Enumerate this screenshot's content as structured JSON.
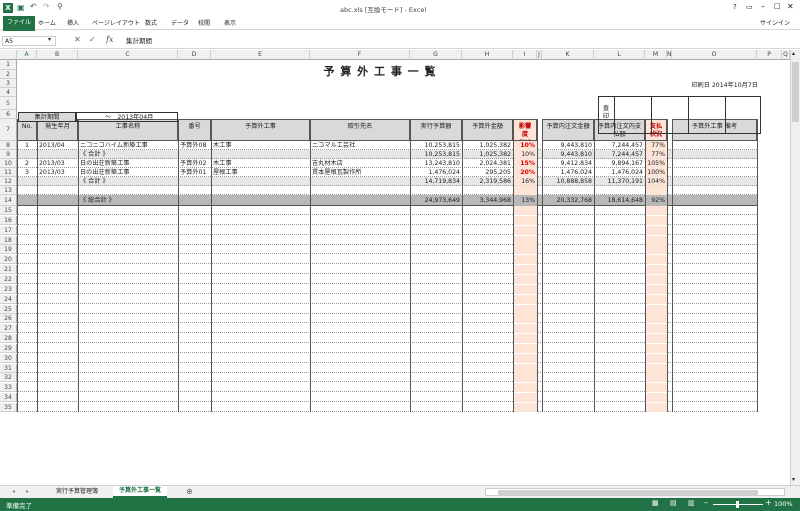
{
  "window": {
    "title": "abc.xls [互換モード] - Excel",
    "help": "?",
    "signin": "サインイン"
  },
  "ribbon_tabs": [
    "ファイル",
    "ホーム",
    "挿入",
    "ページレイアウト",
    "数式",
    "データ",
    "校閲",
    "表示"
  ],
  "formula_bar": {
    "name_box": "A5",
    "fx": "fx",
    "content": "集計期間"
  },
  "columns": [
    "A",
    "B",
    "C",
    "D",
    "E",
    "F",
    "G",
    "H",
    "I",
    "J",
    "K",
    "L",
    "M",
    "N",
    "O",
    "P",
    "Q",
    "R"
  ],
  "sheet": {
    "title": "予 算 外 工 事 一 覧",
    "print_date": "印刷日 2014年10月7日",
    "approval_label": "査印",
    "period_label": "集計期間",
    "period_value": "～　2013年04月",
    "headers": {
      "no": "No.",
      "date": "発生年月",
      "project": "工事名称",
      "code": "番号",
      "extra_work": "予算外工事",
      "vendor": "取引先名",
      "budget": "実行予算額",
      "extra_amount": "予算外金額",
      "impact": "影響度(%)",
      "order_amount": "予算内注文金額",
      "paid_amount": "予算内注文内支払額",
      "pay_status": "支払状況",
      "remarks": "予算外工事 備考"
    },
    "rows": [
      {
        "r": "8",
        "no": "1",
        "date": "2013/04",
        "project": "ニコニコハイム新築工事",
        "code": "予算外08",
        "extra_work": "木工事",
        "vendor": "ニコマル工芸社",
        "budget": "10,253,815",
        "extra_amount": "1,025,382",
        "impact": "10%",
        "order_amount": "9,443,810",
        "paid_amount": "7,244,457",
        "pay_status": "77%",
        "style": "normal"
      },
      {
        "r": "9",
        "project": "《 合計 》",
        "budget": "10,253,815",
        "extra_amount": "1,025,382",
        "impact": "10%",
        "order_amount": "9,443,810",
        "paid_amount": "7,244,457",
        "pay_status": "77%",
        "style": "subtotal"
      },
      {
        "r": "10",
        "no": "2",
        "date": "2013/03",
        "project": "日の出荘新築工事",
        "code": "予算外02",
        "extra_work": "木工事",
        "vendor": "吉丸材木店",
        "budget": "13,243,810",
        "extra_amount": "2,024,381",
        "impact": "15%",
        "order_amount": "9,412,834",
        "paid_amount": "9,894,167",
        "pay_status": "105%",
        "style": "normal"
      },
      {
        "r": "11",
        "no": "3",
        "date": "2013/03",
        "project": "日の出荘新築工事",
        "code": "予算外01",
        "extra_work": "屋根工事",
        "vendor": "貫本屋根瓦製作所",
        "budget": "1,476,024",
        "extra_amount": "295,205",
        "impact": "20%",
        "order_amount": "1,476,024",
        "paid_amount": "1,476,024",
        "pay_status": "100%",
        "style": "normal"
      },
      {
        "r": "12",
        "project": "《 合計 》",
        "budget": "14,719,834",
        "extra_amount": "2,319,586",
        "impact": "16%",
        "order_amount": "10,888,858",
        "paid_amount": "11,370,191",
        "pay_status": "104%",
        "style": "subtotal"
      },
      {
        "r": "13",
        "style": "blank"
      },
      {
        "r": "14",
        "project": "《 総合計 》",
        "budget": "24,973,649",
        "extra_amount": "3,344,968",
        "impact": "13%",
        "order_amount": "20,332,768",
        "paid_amount": "18,614,648",
        "pay_status": "92%",
        "style": "grand"
      }
    ],
    "top_rows": [
      "1",
      "2",
      "3",
      "4",
      "5",
      "6",
      "7"
    ],
    "empty_rows": [
      "15",
      "16",
      "17",
      "18",
      "19",
      "20",
      "21",
      "22",
      "23",
      "24",
      "25",
      "26",
      "27",
      "28",
      "29",
      "30",
      "31",
      "32",
      "33",
      "34",
      "35"
    ]
  },
  "sheet_tabs": [
    "実行予算管理簿",
    "予算外工事一覧"
  ],
  "active_sheet": "予算外工事一覧",
  "add_sheet": "⊕",
  "status": {
    "ready": "準備完了",
    "zoom": "100%"
  },
  "colors": {
    "excel_green": "#217346",
    "impact_fill": "#fce4d6",
    "subtotal_fill": "#e6e6e6",
    "grand_fill": "#b8b8b8",
    "header_fill": "#d9d9d9"
  }
}
